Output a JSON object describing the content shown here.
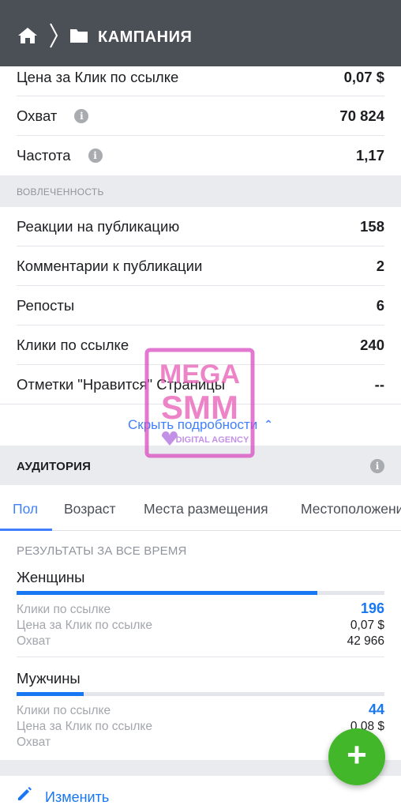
{
  "colors": {
    "header_bg": "#4b4f56",
    "accent_blue": "#1877f2",
    "link_blue": "#4080ff",
    "fab_green": "#42b72a",
    "section_gray": "#e9ebee"
  },
  "header": {
    "title": "КАМПАНИЯ",
    "home_icon": "home-icon",
    "folder_icon": "folder-icon"
  },
  "metrics_top": [
    {
      "label": "Цена за Клик по ссылке",
      "value": "0,07 $",
      "info": false
    },
    {
      "label": "Охват",
      "value": "70 824",
      "info": true
    },
    {
      "label": "Частота",
      "value": "1,17",
      "info": true
    }
  ],
  "engagement": {
    "section_label": "ВОВЛЕЧЕННОСТЬ",
    "rows": [
      {
        "label": "Реакции на публикацию",
        "value": "158"
      },
      {
        "label": "Комментарии к публикации",
        "value": "2"
      },
      {
        "label": "Репосты",
        "value": "6"
      },
      {
        "label": "Клики по ссылке",
        "value": "240"
      },
      {
        "label": "Отметки \"Нравится\" Страницы",
        "value": "--"
      }
    ]
  },
  "hide_details_label": "Скрыть подробности",
  "audience": {
    "title": "АУДИТОРИЯ",
    "tabs": [
      "Пол",
      "Возраст",
      "Места размещения",
      "Местоположение"
    ],
    "active_tab": "Пол",
    "results_label": "РЕЗУЛЬТАТЫ ЗА ВСЕ ВРЕМЯ",
    "groups": [
      {
        "name": "Женщины",
        "share": 0.817,
        "stats": [
          {
            "label": "Клики по ссылке",
            "value": "196"
          },
          {
            "label": "Цена за Клик по ссылке",
            "value": "0,07 $"
          },
          {
            "label": "Охват",
            "value": "42 966"
          }
        ]
      },
      {
        "name": "Мужчины",
        "share": 0.183,
        "stats": [
          {
            "label": "Клики по ссылке",
            "value": "44"
          },
          {
            "label": "Цена за Клик по ссылке",
            "value": "0,08 $"
          },
          {
            "label": "Охват",
            "value": ""
          }
        ]
      }
    ]
  },
  "edit_label": "Изменить",
  "fab_icon": "plus-icon",
  "watermark": {
    "line1": "MEGA",
    "line2": "SMM",
    "line3": "DIGITAL AGENCY"
  }
}
